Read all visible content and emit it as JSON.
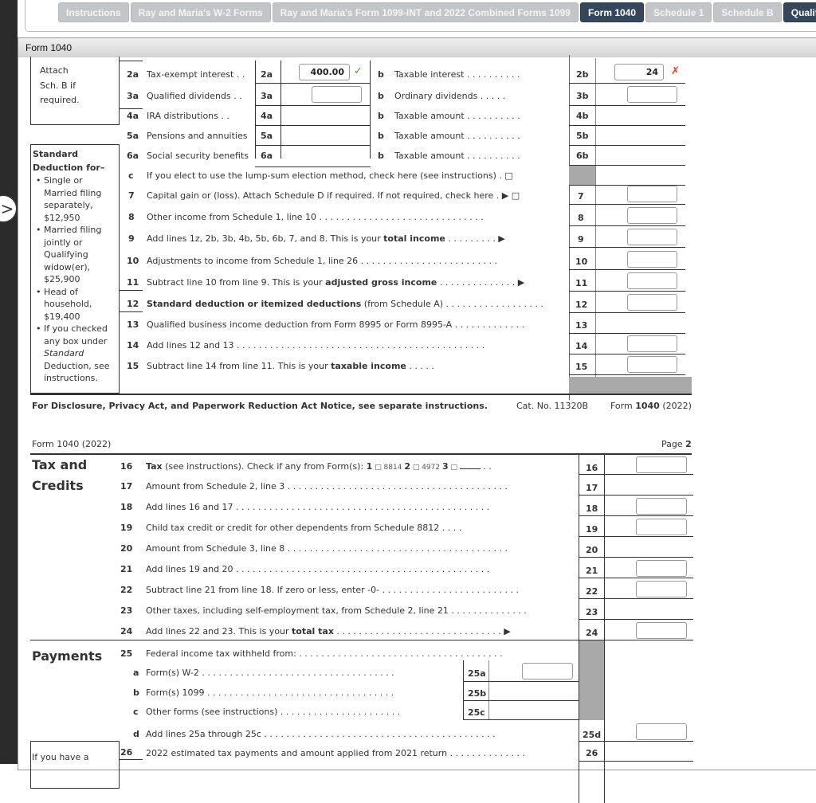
{
  "tabs": [
    {
      "label": "Instructions",
      "active": false
    },
    {
      "label": "Ray and Maria's W-2 Forms",
      "active": false
    },
    {
      "label": "Ray and Maria's Form 1099-INT and 2022 Combined Forms 1099",
      "active": false
    },
    {
      "label": "Form 1040",
      "active": true
    },
    {
      "label": "Schedule 1",
      "active": false
    },
    {
      "label": "Schedule B",
      "active": false
    },
    {
      "label": "Qualified D",
      "active": true
    }
  ],
  "panel": {
    "title": "Form 1040"
  },
  "nav_toggle": {
    "icon": "chevron-right-icon",
    "glyph": ">"
  },
  "page1": {
    "attach_note": [
      "Attach",
      "Sch. B if",
      "required."
    ],
    "std_deduction": {
      "title1": "Standard",
      "title2": "Deduction for–",
      "items": [
        [
          "Single or",
          "Married filing",
          "separately,",
          "$12,950"
        ],
        [
          "Married filing",
          "jointly or",
          "Qualifying",
          "widow(er),",
          "$25,900"
        ],
        [
          "Head of",
          "household,",
          "$19,400"
        ],
        [
          "If you checked",
          "any box under",
          "Standard",
          "Deduction, see",
          "instructions."
        ]
      ]
    },
    "pair_lines": [
      {
        "num": "2a",
        "label": "Tax-exempt interest . .",
        "box": "2a",
        "value": "400.00",
        "status": "correct",
        "b_label": "Taxable interest . . . . . . . . . .",
        "b_box": "2b",
        "b_value": "24",
        "b_status": "incorrect"
      },
      {
        "num": "3a",
        "label": "Qualified dividends . .",
        "box": "3a",
        "value": "",
        "b_label": "Ordinary dividends . . . . .",
        "b_box": "3b",
        "b_value": ""
      },
      {
        "num": "4a",
        "label": "IRA distributions . .",
        "box": "4a",
        "b_label": "Taxable amount . . . . . . . . . .",
        "b_box": "4b"
      },
      {
        "num": "5a",
        "label": "Pensions and annuities",
        "box": "5a",
        "b_label": "Taxable amount . . . . . . . . . .",
        "b_box": "5b"
      },
      {
        "num": "6a",
        "label": "Social security benefits",
        "box": "6a",
        "b_label": "Taxable amount . . . . . . . . . .",
        "b_box": "6b"
      }
    ],
    "b_letter": "b",
    "line6c": {
      "num": "c",
      "label": "If you elect to use the lump-sum election method, check here (see instructions) . □"
    },
    "lines": [
      {
        "num": "7",
        "label": "Capital gain or (loss). Attach Schedule D if required. If not required, check here . ▶ □",
        "box": "7"
      },
      {
        "num": "8",
        "label": "Other income from Schedule 1, line 10 . . . . . . . . . . . . . . . . . . . . . . . . . . . . . .",
        "box": "8"
      },
      {
        "num": "9",
        "label_pre": "Add lines 1z, 2b, 3b, 4b, 5b, 6b, 7, and 8. This is your ",
        "label_bold": "total income",
        "label_post": " . . . . . . . . . ▶",
        "box": "9"
      },
      {
        "num": "10",
        "label": "Adjustments to income from Schedule 1, line 26 . . . . . . . . . . . . . . . . . . . . . . . . .",
        "box": "10"
      },
      {
        "num": "11",
        "label_pre": "Subtract line 10 from line 9. This is your ",
        "label_bold": "adjusted gross income",
        "label_post": " . . . . . . . . . . . . . . ▶",
        "box": "11"
      },
      {
        "num": "12",
        "label_bold": "Standard deduction or itemized deductions",
        "label_post": " (from Schedule A) . . . . . . . . . . . . . . . . . .",
        "box": "12"
      },
      {
        "num": "13",
        "label": "Qualified business income deduction from Form 8995 or Form 8995-A . . . . . . . . . . . . .",
        "box": "13"
      },
      {
        "num": "14",
        "label": "Add lines 12 and 13 . . . . . . . . . . . . . . . . . . . . . . . . . . . . . . . . . . . . . . . . . . . . .",
        "box": "14"
      },
      {
        "num": "15",
        "label_pre": "Subtract line 14 from line 11. This is your ",
        "label_bold": "taxable income",
        "label_post": " . . . . .",
        "box": "15"
      }
    ],
    "footer": {
      "notice": "For Disclosure, Privacy Act, and Paperwork Reduction Act Notice, see separate instructions.",
      "cat_no": "Cat. No. 11320B",
      "form_pre": "Form ",
      "form_bold": "1040",
      "form_post": " (2022)"
    }
  },
  "page2": {
    "header_left": "Form 1040 (2022)",
    "header_right_pre": "Page ",
    "header_right_bold": "2",
    "tax_credits_title": [
      "Tax and",
      "Credits"
    ],
    "line16": {
      "num": "16",
      "bold": "Tax",
      "text": " (see instructions). Check if any from Form(s):  ",
      "opt1": "1",
      "opt1_label": " □ 8814  ",
      "opt2": "2",
      "opt2_label": " □ 4972  ",
      "opt3": "3",
      "opt3_label": " □ ",
      "tail": " . .",
      "box": "16"
    },
    "lines": [
      {
        "num": "17",
        "label": "Amount from Schedule 2, line 3 . . . . . . . . . . . . . . . . . . . . . . . . . . . . . . . . . . . . . . . .",
        "box": "17",
        "input": false
      },
      {
        "num": "18",
        "label": "Add lines 16 and 17 . . . . . . . . . . . . . . . . . . . . . . . . . . . . . . . . . . . . . . . . . . . . . .",
        "box": "18",
        "input": true
      },
      {
        "num": "19",
        "label": "Child tax credit or credit for other dependents from Schedule 8812 . . . .",
        "box": "19",
        "input": true
      },
      {
        "num": "20",
        "label": "Amount from Schedule 3, line 8 . . . . . . . . . . . . . . . . . . . . . . . . . . . . . . . . . . . . . . . .",
        "box": "20",
        "input": false
      },
      {
        "num": "21",
        "label": "Add lines 19 and 20 . . . . . . . . . . . . . . . . . . . . . . . . . . . . . . . . . . . . . . . . . . . . . .",
        "box": "21",
        "input": true
      },
      {
        "num": "22",
        "label": "Subtract line 21 from line 18. If zero or less, enter -0- . . . . . . . . . . . . . . . . . . . . . . . . .",
        "box": "22",
        "input": true
      },
      {
        "num": "23",
        "label": "Other taxes, including self-employment tax, from Schedule 2, line 21 . . . . . . . . . . . . . .",
        "box": "23",
        "input": false
      },
      {
        "num": "24",
        "label_pre": "Add lines 22 and 23. This is your ",
        "label_bold": "total tax",
        "label_post": " . . . . . . . . . . . . . . . . . . . . . . . . . . . . . . ▶",
        "box": "24",
        "input": true
      }
    ],
    "payments_title": "Payments",
    "line25": {
      "num": "25",
      "label": "Federal income tax withheld from: . . . . . . . . . . . . . . . . . . . . . . . . . . . . . . . . . . . . ."
    },
    "line25_subs": [
      {
        "letter": "a",
        "label": "Form(s) W-2 . . . . . . . . . . . . . . . . . . . . . . . . . . . . . . . . . . .",
        "box": "25a",
        "input": true
      },
      {
        "letter": "b",
        "label": "Form(s) 1099 . . . . . . . . . . . . . . . . . . . . . . . . . . . . . . . . . .",
        "box": "25b",
        "input": false
      },
      {
        "letter": "c",
        "label": "Other forms (see instructions) . . . . . . . . . . . . . . . . . . . . . .",
        "box": "25c",
        "input": false
      }
    ],
    "line25d": {
      "letter": "d",
      "label": "Add lines 25a through 25c . . . . . . . . . . . . . . . . . . . . . . . . . . . . . . . . . . . . . . . . . .",
      "box": "25d"
    },
    "line26": {
      "num": "26",
      "label": "2022 estimated tax payments and amount applied from 2021 return . . . . . . . . . . . . . .",
      "box": "26"
    },
    "side_note": "If you have a"
  },
  "status_colors": {
    "correct": "#4a9a3a",
    "incorrect": "#e23a2a",
    "tab_active": "#34475d",
    "tab_inactive": "#c3c6c9"
  }
}
